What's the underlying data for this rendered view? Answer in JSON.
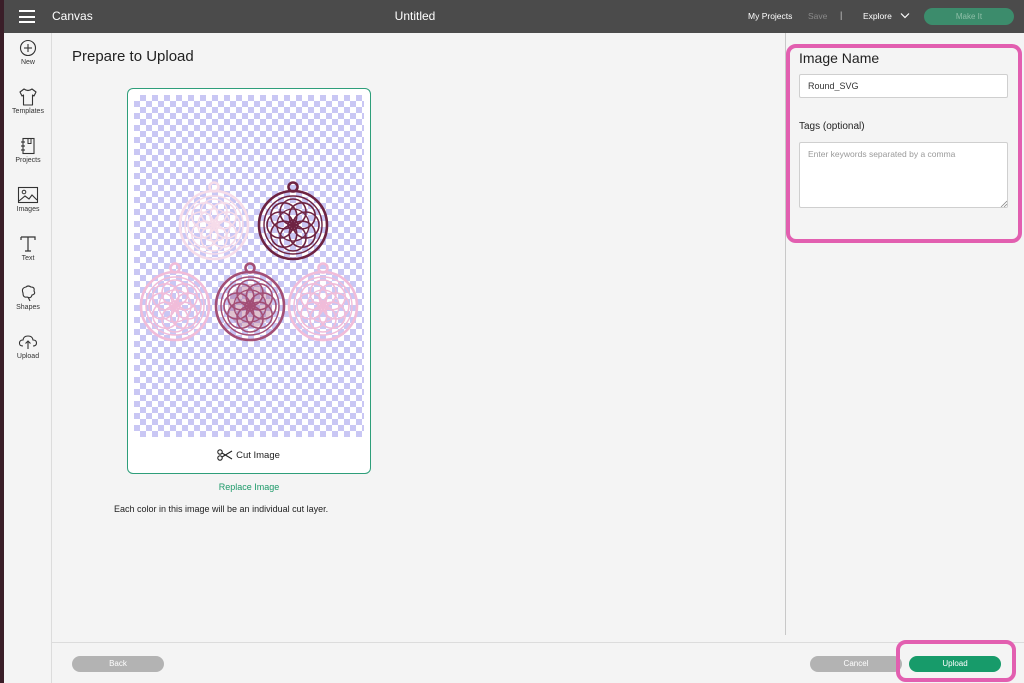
{
  "topbar": {
    "app_title": "Canvas",
    "document_title": "Untitled",
    "my_projects": "My Projects",
    "save": "Save",
    "separator": "|",
    "explore": "Explore",
    "make_it": "Make It"
  },
  "sidebar": {
    "items": [
      {
        "label": "New",
        "icon": "plus-circle-icon"
      },
      {
        "label": "Templates",
        "icon": "shirt-icon"
      },
      {
        "label": "Projects",
        "icon": "notebook-icon"
      },
      {
        "label": "Images",
        "icon": "image-icon"
      },
      {
        "label": "Text",
        "icon": "text-icon"
      },
      {
        "label": "Shapes",
        "icon": "shapes-icon"
      },
      {
        "label": "Upload",
        "icon": "cloud-upload-icon"
      }
    ]
  },
  "main": {
    "title": "Prepare to Upload",
    "cut_image": "Cut Image",
    "replace_image": "Replace Image",
    "description": "Each color in this image will be an individual cut layer."
  },
  "panel": {
    "image_name_label": "Image Name",
    "image_name_value": "Round_SVG",
    "tags_label": "Tags (optional)",
    "tags_placeholder": "Enter keywords separated by a comma"
  },
  "footer": {
    "back": "Back",
    "cancel": "Cancel",
    "upload": "Upload"
  },
  "colors": {
    "topbar": "#4b4b4b",
    "accent_green": "#179b6a",
    "highlight_pink": "#e25fb0",
    "ornament_dark": "#6e2342",
    "ornament_mid": "#a34e75",
    "ornament_light": "#f1bcd9",
    "ornament_pale": "#f6dcea"
  }
}
